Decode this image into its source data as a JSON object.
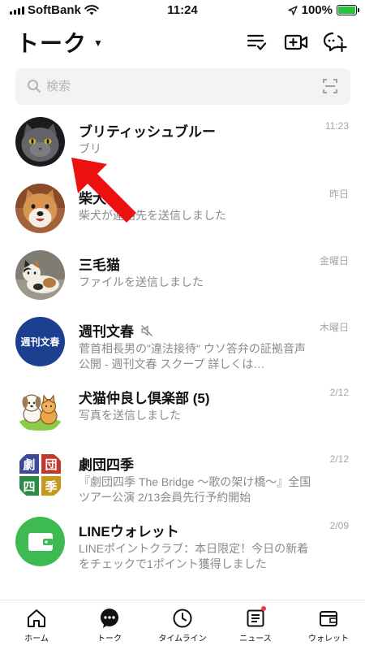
{
  "status": {
    "carrier": "SoftBank",
    "time": "11:24",
    "battery": "100%"
  },
  "header": {
    "title": "トーク",
    "icons": [
      "edit-list-icon",
      "video-call-icon",
      "new-chat-icon"
    ]
  },
  "search": {
    "placeholder": "検索"
  },
  "chats": [
    {
      "name": "ブリティッシュブルー",
      "preview": "ブリ",
      "time": "11:23",
      "avatar": "gray-cat-photo"
    },
    {
      "name": "柴犬",
      "preview": "柴犬が連絡先を送信しました",
      "time": "昨日",
      "avatar": "shiba-dog-photo"
    },
    {
      "name": "三毛猫",
      "preview": "ファイルを送信しました",
      "time": "金曜日",
      "avatar": "calico-cat-photo"
    },
    {
      "name": "週刊文春",
      "preview": "菅首相長男の\"違法接待\" ウソ答弁の証拠音声公開 - 週刊文春 スクープ 詳しくは…",
      "time": "木曜日",
      "avatar": "weekly-bunshun-logo",
      "muted": true
    },
    {
      "name": "犬猫仲良し倶楽部 (5)",
      "preview": "写真を送信しました",
      "time": "2/12",
      "avatar": "dog-cat-illustration"
    },
    {
      "name": "劇団四季",
      "preview": "『劇団四季 The Bridge 〜歌の架け橋〜』全国ツアー公演 2/13会員先行予約開始",
      "time": "2/12",
      "avatar": "shiki-logo",
      "logo_chars": [
        "劇",
        "団",
        "四",
        "季"
      ]
    },
    {
      "name": "LINEウォレット",
      "preview": "LINEポイントクラブ：本日限定！今日の新着をチェックで1ポイント獲得しました",
      "time": "2/09",
      "avatar": "wallet-logo"
    }
  ],
  "avatar_labels": {
    "bunshun": "週刊文春"
  },
  "tabs": [
    {
      "label": "ホーム",
      "icon": "home-icon",
      "active": false
    },
    {
      "label": "トーク",
      "icon": "chat-icon",
      "active": true
    },
    {
      "label": "タイムライン",
      "icon": "clock-icon",
      "active": false
    },
    {
      "label": "ニュース",
      "icon": "news-icon",
      "active": false,
      "badge": true
    },
    {
      "label": "ウォレット",
      "icon": "wallet-icon",
      "active": false
    }
  ],
  "colors": {
    "accent_green": "#3dbb52",
    "badge_red": "#f2384b",
    "annotation_arrow": "#ee1111",
    "bunshun_blue": "#1d3f8f"
  }
}
